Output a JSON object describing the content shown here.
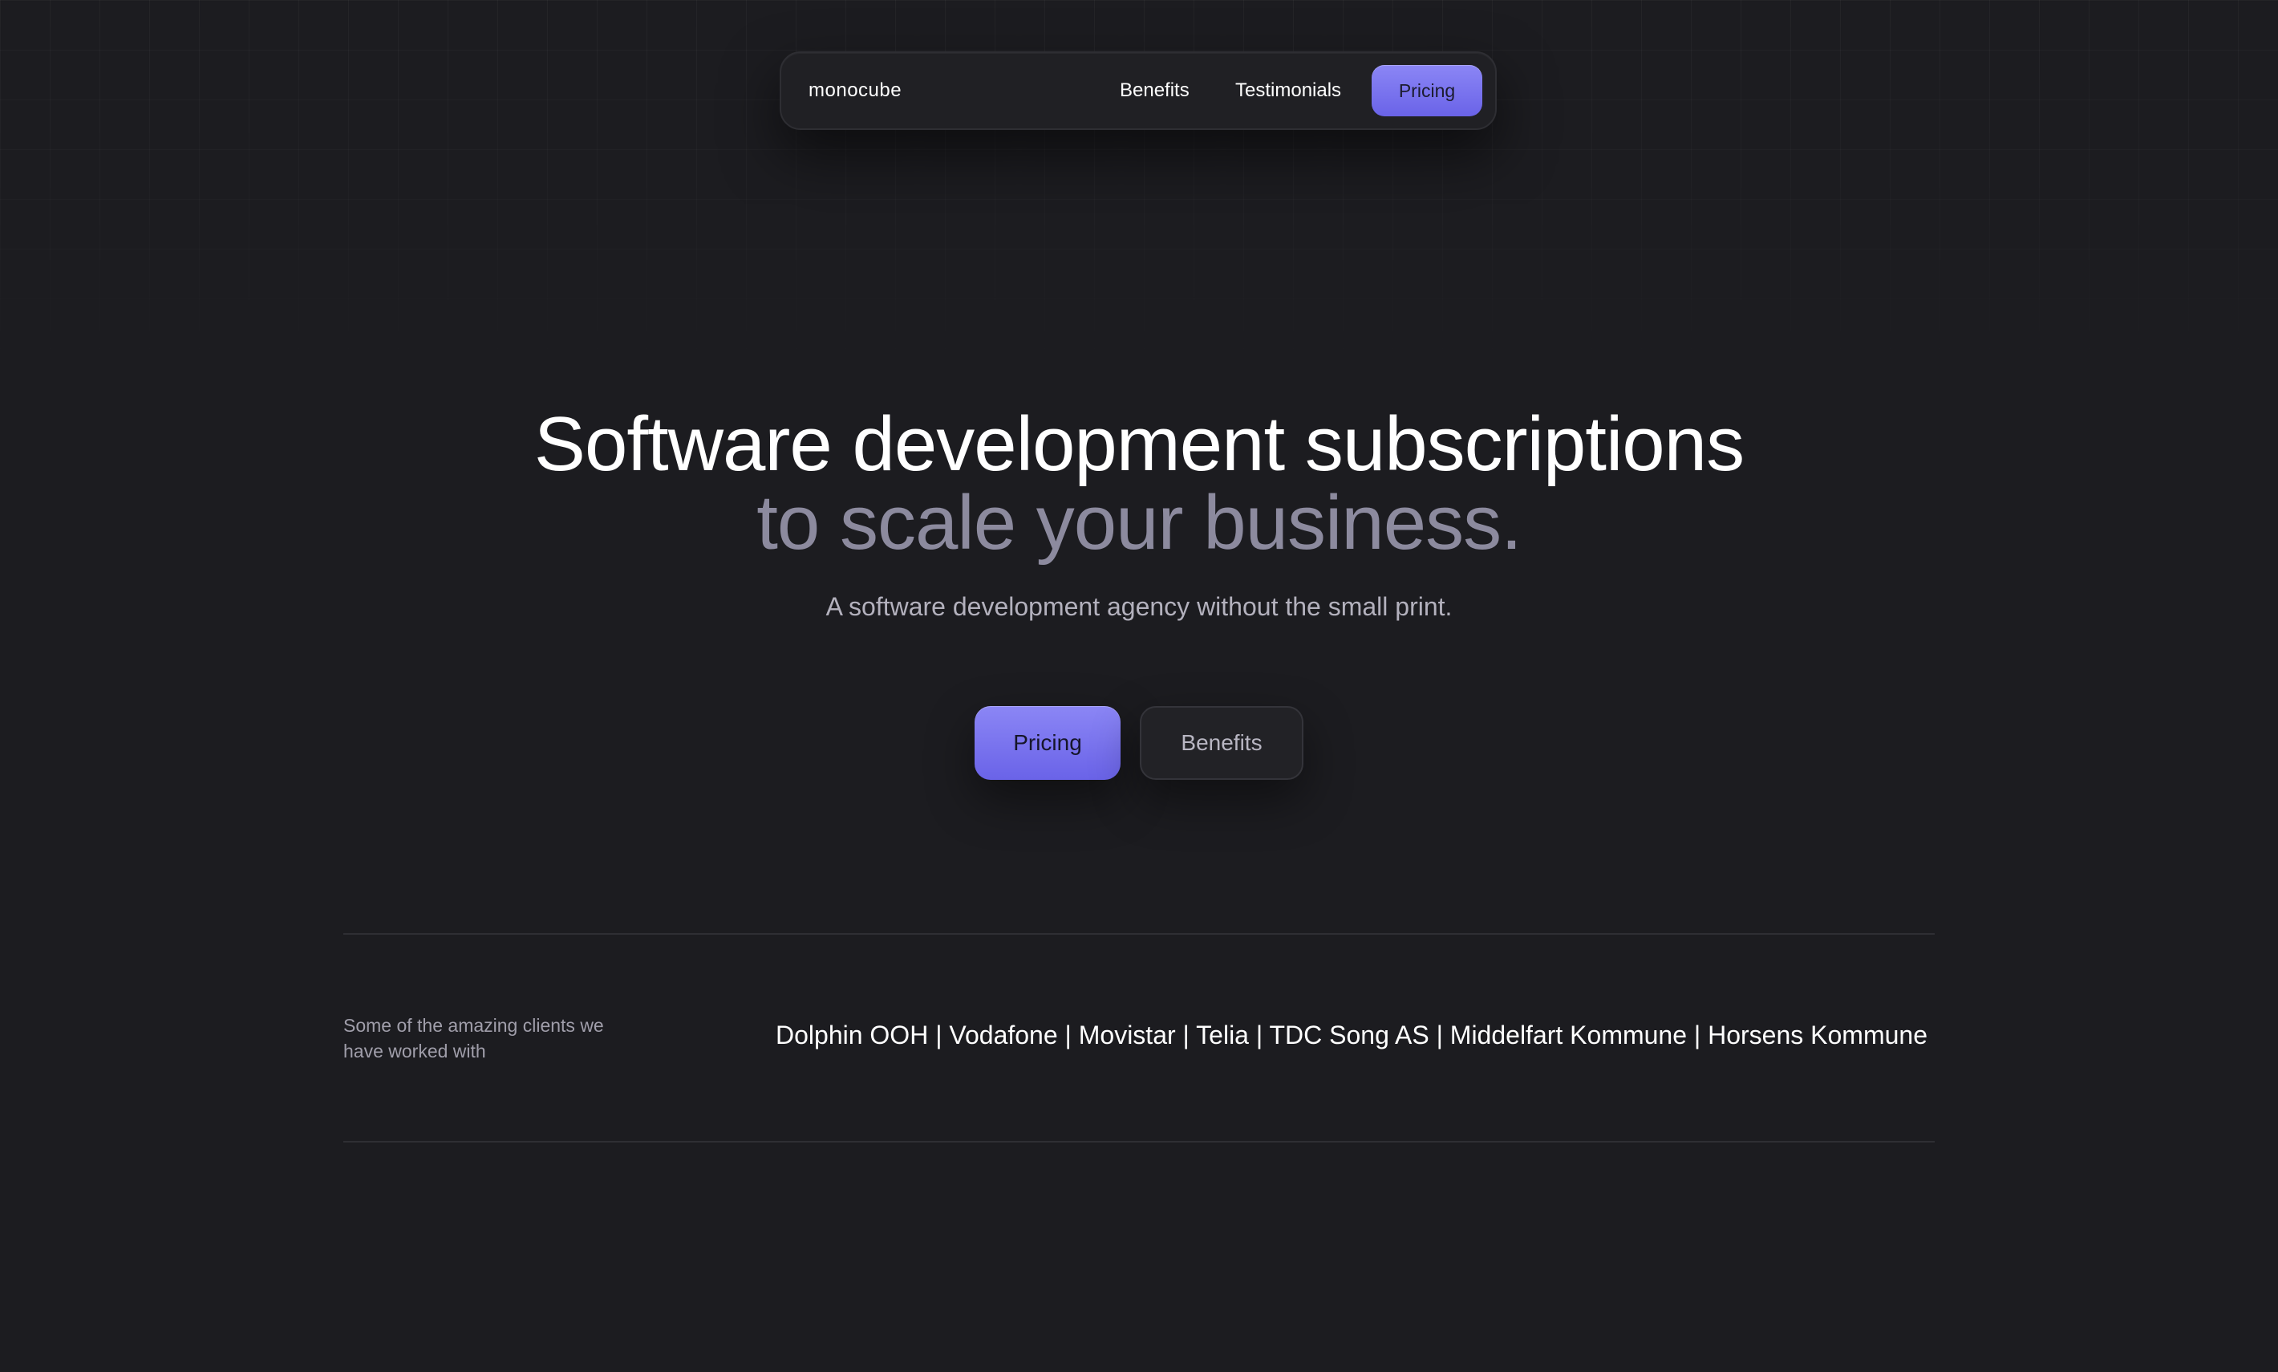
{
  "nav": {
    "logo": "monocube",
    "links": [
      {
        "label": "Benefits"
      },
      {
        "label": "Testimonials"
      }
    ],
    "cta_label": "Pricing"
  },
  "hero": {
    "title_line1": "Software development subscriptions",
    "title_line2": "to scale your business.",
    "subtitle": "A software development agency without the small print.",
    "primary_cta": "Pricing",
    "secondary_cta": "Benefits"
  },
  "clients": {
    "label": "Some of the amazing clients we have worked with",
    "list": "Dolphin OOH | Vodafone | Movistar | Telia | TDC Song AS | Middelfart Kommune | Horsens Kommune"
  },
  "colors": {
    "background": "#1c1c20",
    "accent": "#7a74ee",
    "muted_title": "#8c8a9e"
  }
}
